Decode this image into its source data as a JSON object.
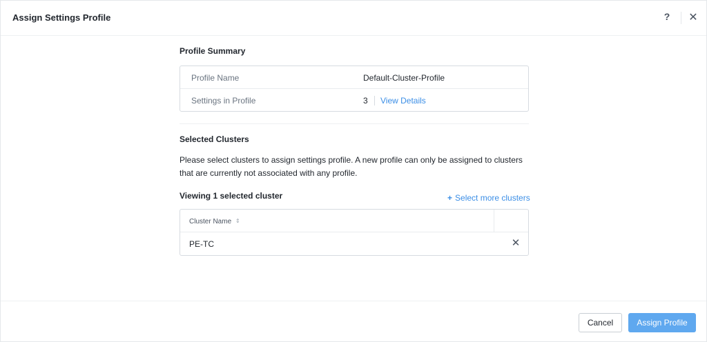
{
  "header": {
    "title": "Assign Settings Profile",
    "help_icon": "question-mark-icon",
    "help_glyph": "?",
    "close_icon": "close-icon",
    "close_glyph": "✕"
  },
  "profile_summary": {
    "title": "Profile Summary",
    "rows": [
      {
        "label": "Profile Name",
        "value": "Default-Cluster-Profile"
      },
      {
        "label": "Settings in Profile",
        "value": "3",
        "link": "View Details"
      }
    ]
  },
  "selected_clusters": {
    "title": "Selected Clusters",
    "description": "Please select clusters to assign settings profile. A new profile can only be assigned to clusters that are currently not associated with any profile.",
    "viewing_text": "Viewing 1 selected cluster",
    "select_more_icon": "plus-icon",
    "select_more_glyph": "+",
    "select_more_label": "Select more clusters",
    "table": {
      "columns": [
        {
          "label": "Cluster Name",
          "sort_icon": "sort-icon",
          "sort_glyph": "⇕"
        }
      ],
      "rows": [
        {
          "name": "PE-TC",
          "remove_icon": "close-icon",
          "remove_glyph": "✕"
        }
      ]
    }
  },
  "footer": {
    "cancel_label": "Cancel",
    "assign_label": "Assign Profile"
  },
  "colors": {
    "accent": "#3b8ee6",
    "primary_button": "#5fa8ef",
    "border": "#d6dbe0"
  }
}
